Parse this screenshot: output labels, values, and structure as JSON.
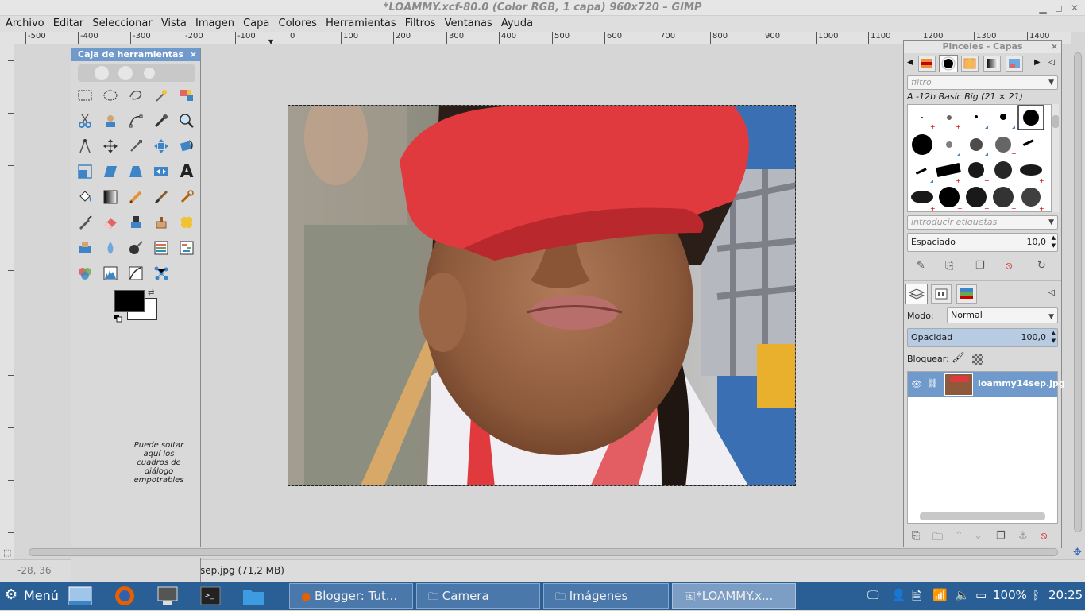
{
  "window": {
    "title": "*LOAMMY.xcf-80.0 (Color RGB, 1 capa) 960x720 – GIMP"
  },
  "menu": [
    "Archivo",
    "Editar",
    "Seleccionar",
    "Vista",
    "Imagen",
    "Capa",
    "Colores",
    "Herramientas",
    "Filtros",
    "Ventanas",
    "Ayuda"
  ],
  "ruler": {
    "h": [
      "-500",
      "-400",
      "-300",
      "-200",
      "-100",
      "0",
      "100",
      "200",
      "300",
      "400",
      "500",
      "600",
      "700",
      "800",
      "900",
      "1000",
      "1100",
      "1200",
      "1300",
      "1400"
    ]
  },
  "toolbox": {
    "title": "Caja de herramientas",
    "close": "×",
    "drop_note": "Puede soltar aquí los cuadros de diálogo empotrables",
    "tools": [
      "rect-select",
      "ellipse-select",
      "free-select",
      "fuzzy-select",
      "select-by-color",
      "scissors",
      "foreground-select",
      "paths",
      "color-picker",
      "zoom",
      "measure",
      "move",
      "align",
      "crop",
      "rotate",
      "scale",
      "shear",
      "perspective",
      "flip",
      "text",
      "bucket-fill",
      "blend",
      "pencil",
      "paintbrush",
      "eraser-airbrush",
      "ink",
      "heal",
      "clone",
      "perspective-clone",
      "smudge",
      "blur",
      "dodge-burn",
      "unified-transform",
      "cage",
      "warp",
      "levels",
      "curves",
      "threshold",
      "hue",
      "color-balance"
    ],
    "fg_color": "#000000",
    "bg_color": "#ffffff"
  },
  "dock": {
    "title": "Pinceles - Capas",
    "filter_placeholder": "filtro",
    "brush_name": "A -12b Basic Big (21 × 21)",
    "tags_placeholder": "introducir etiquetas",
    "spacing_label": "Espaciado",
    "spacing_value": "10,0",
    "mode_label": "Modo:",
    "mode_value": "Normal",
    "opacity_label": "Opacidad",
    "opacity_value": "100,0",
    "lock_label": "Bloquear:",
    "layer_name": "loammy14sep.jpg"
  },
  "status": {
    "coords": "-28, 36",
    "file": "sep.jpg (71,2 MB)"
  },
  "taskbar": {
    "menu_label": "Menú",
    "windows": [
      "Blogger: Tut...",
      "Camera",
      "Imágenes",
      "*LOAMMY.x..."
    ],
    "battery": "100%",
    "clock": "20:25"
  },
  "colors": {
    "accent": "#6f9acb",
    "taskbar": "#2a5f96",
    "cap_red": "#e03a3f"
  }
}
